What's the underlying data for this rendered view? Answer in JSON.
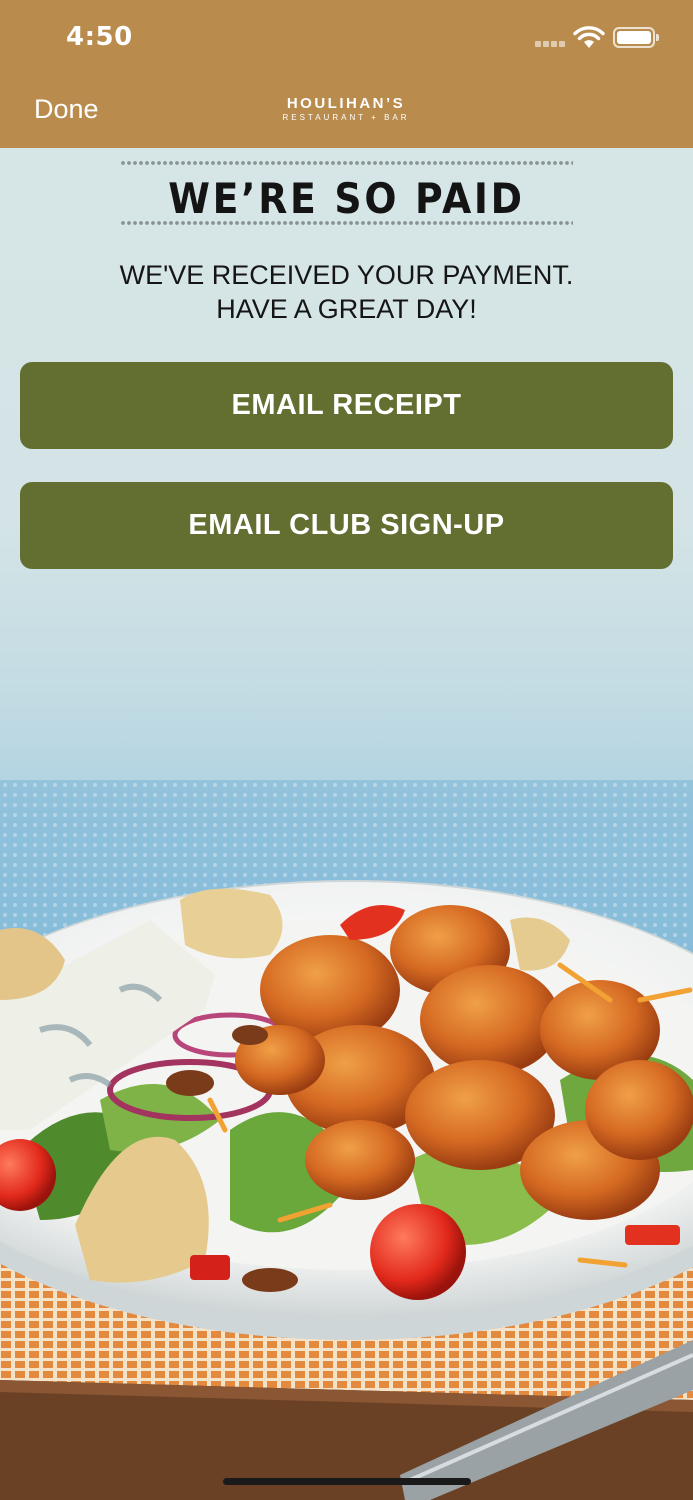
{
  "status_bar": {
    "time": "4:50",
    "signal_icon": "cellular-signal-icon",
    "wifi_icon": "wifi-icon",
    "battery_icon": "battery-icon"
  },
  "nav": {
    "done_label": "Done",
    "brand_name": "HOULIHAN’S",
    "brand_sub": "RESTAURANT + BAR",
    "background": "#b98c4e"
  },
  "confirmation": {
    "title": "WE’RE SO PAID",
    "message_line1": "WE'VE RECEIVED YOUR PAYMENT.",
    "message_line2": "HAVE A GREAT DAY!"
  },
  "actions": {
    "email_receipt_label": "EMAIL RECEIPT",
    "email_club_label": "EMAIL CLUB SIGN-UP",
    "button_color": "#636e31"
  },
  "hero_image": {
    "icon": "food-salad-image"
  }
}
